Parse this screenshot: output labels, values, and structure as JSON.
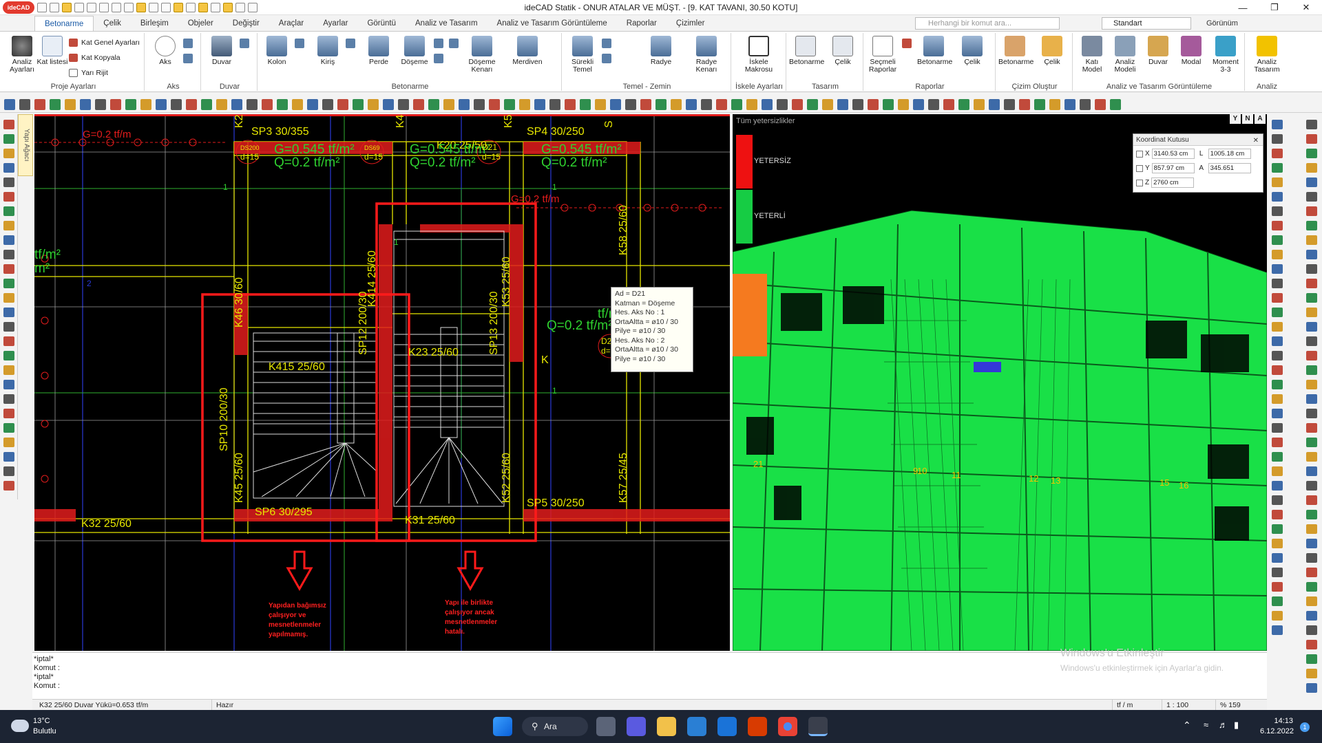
{
  "app": {
    "title": "ideCAD Statik - ONUR ATALAR VE MÜŞT. - [9. KAT TAVANI, 30.50 KOTU]",
    "logo": "ideCAD"
  },
  "tabs": [
    "Betonarme",
    "Çelik",
    "Birleşim",
    "Objeler",
    "Değiştir",
    "Araçlar",
    "Ayarlar",
    "Görüntü",
    "Analiz ve Tasarım",
    "Analiz ve Tasarım Görüntüleme",
    "Raporlar",
    "Çizimler"
  ],
  "search": {
    "placeholder": "Herhangi bir komut ara..."
  },
  "style_combo": "Standart",
  "view_combo": "Görünüm",
  "ribbon": {
    "proje": {
      "label": "Proje Ayarları",
      "analiz": "Analiz Ayarları",
      "kat_listesi": "Kat listesi",
      "kat_genel": "Kat Genel Ayarları",
      "kat_kopyala": "Kat Kopyala",
      "yari_rijit": "Yarı Rijit"
    },
    "aks": {
      "label": "Aks",
      "btn": "Aks"
    },
    "duvar": {
      "label": "Duvar",
      "btn": "Duvar"
    },
    "betonarme": {
      "label": "Betonarme",
      "kolon": "Kolon",
      "kiris": "Kiriş",
      "perde": "Perde",
      "doseme": "Döşeme",
      "doseme_kenari": "Döşeme Kenarı",
      "merdiven": "Merdiven"
    },
    "temel": {
      "label": "Temel - Zemin",
      "surekli": "Sürekli Temel",
      "radye": "Radye",
      "radye_kenari": "Radye Kenarı"
    },
    "iskele": {
      "label": "İskele Ayarları",
      "btn": "İskele Makrosu"
    },
    "tasarim": {
      "label": "Tasarım",
      "betonarme": "Betonarme",
      "celik": "Çelik"
    },
    "raporlar": {
      "label": "Raporlar",
      "secmeli": "Seçmeli Raporlar",
      "betonarme": "Betonarme",
      "celik": "Çelik"
    },
    "cizim": {
      "label": "Çizim Oluştur",
      "betonarme": "Betonarme",
      "celik": "Çelik"
    },
    "atg": {
      "label": "Analiz ve Tasarım Görüntüleme",
      "kati_model": "Katı Model",
      "analiz_modeli": "Analiz Modeli",
      "duvar": "Duvar",
      "modal": "Modal",
      "moment": "Moment 3-3"
    },
    "analiz": {
      "label": "Analiz",
      "btn": "Analiz Tasarım"
    }
  },
  "side_tab": "Yapı Ağacı",
  "plan": {
    "labels": {
      "sp3": "SP3 30/355",
      "sp4": "SP4 30/250",
      "k20": "K20 25/50",
      "g1": "G=0.2 tf/m",
      "g2": "G=0.2 tf/m",
      "load1a": "G=0.545 tf/m²",
      "load1b": "Q=0.2 tf/m²",
      "load2a": "G=0.545 tf/m²",
      "load2b": "Q=0.2 tf/m²",
      "load3a": "G=0.545 tf/m²",
      "load3b": "Q=0.2 tf/m²",
      "load4a": "tf/m²",
      "load4b": "Q=0.2 tf/m²",
      "left_a": "tf/m²",
      "left_b": "m²",
      "ds200": "DS200",
      "d15a": "d=15",
      "ds69": "DS69",
      "d15b": "d=15",
      "d21": "D21",
      "d15c": "d=15",
      "d2x": "D2",
      "d_eq": "d=",
      "k414": "K414 25/60",
      "k53": "K53 25/60",
      "k46": "K46 30/60",
      "k58": "K58 25/60",
      "sp12": "SP12 200/30",
      "sp13": "SP13 200/30",
      "k23": "K23 25/60",
      "k415": "K415 25/60",
      "sp10": "SP10 200/30",
      "k45": "K45 25/60",
      "k57": "K57 25/45",
      "k52": "K52 25/60",
      "sp6": "SP6 30/295",
      "sp5": "SP5 30/250",
      "k31": "K31 25/60",
      "k32": "K32 25/60",
      "k2": "K2",
      "k4": "K4",
      "k5": "K5",
      "s5": "S",
      "k_mid": "K",
      "n1": "1",
      "n2": "1",
      "n3": "1",
      "n4": "1",
      "n5": "2"
    },
    "note1": [
      "Yapıdan bağımsız",
      "çalışıyor ve",
      "mesnetlenmeler",
      "yapılmamış."
    ],
    "note2": [
      "Yapı ile birlikte",
      "çalışıyor ancak",
      "mesnetlenmeler",
      "hatalı."
    ]
  },
  "tooltip": [
    "Ad = D21",
    "Katman = Döşeme",
    "Hes. Aks No : 1",
    "OrtaAltta = ø10 / 30",
    "Pilye = ø10 / 30",
    "Hes. Aks No : 2",
    "OrtaAltta = ø10 / 30",
    "Pilye = ø10 / 30"
  ],
  "view3d": {
    "header": "Tüm yetersizlikler",
    "yetersiz": "YETERSİZ",
    "yeterli": "YETERLİ",
    "axis_labels": [
      "9",
      "10",
      "11",
      "12",
      "13",
      "15",
      "16",
      "21"
    ]
  },
  "yn": [
    "Y",
    "N",
    "A"
  ],
  "coord": {
    "title": "Koordinat Kutusu",
    "x_label": "X",
    "x": "3140.53 cm",
    "l_label": "L",
    "l": "1005.18 cm",
    "y_label": "Y",
    "y": "857.97 cm",
    "a_label": "A",
    "a": "345.651",
    "z_label": "Z",
    "z": "2760 cm"
  },
  "command": {
    "lines": [
      "*iptal*",
      "Komut :",
      "*iptal*",
      "Komut :"
    ]
  },
  "watermark": {
    "title": "Windows'u Etkinleştir",
    "sub": "Windows'u etkinleştirmek için Ayarlar'a gidin."
  },
  "status": {
    "msg": "K32 25/60 Duvar Yükü=0.653 tf/m",
    "state": "Hazır",
    "unit": "tf / m",
    "scale": "1 : 100",
    "zoom": "% 159"
  },
  "taskbar": {
    "temp": "13°C",
    "weather": "Bulutlu",
    "search": "Ara",
    "time": "14:13",
    "date": "6.12.2022",
    "notif": "1"
  },
  "colors": {
    "accent": "#1a5aa6",
    "plan_red": "#e21c1c",
    "plan_yellow": "#e6e600",
    "plan_green": "#2fd12f",
    "plan_blue": "#2a3ad8",
    "model_green": "#19e047"
  }
}
